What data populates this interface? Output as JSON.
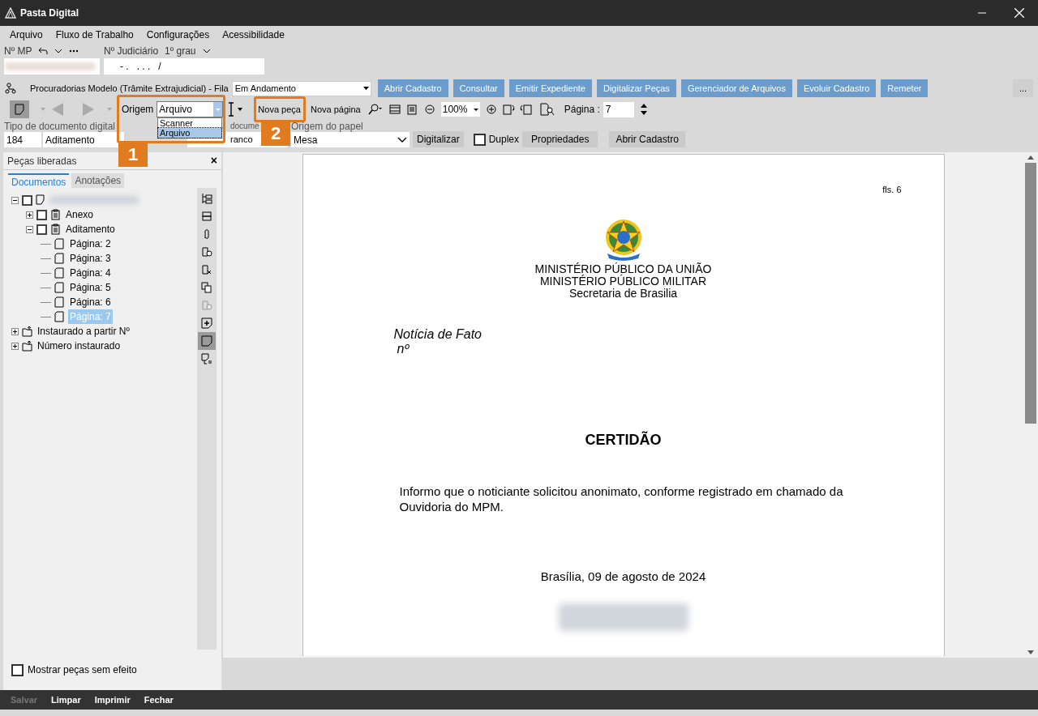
{
  "window": {
    "title": "Pasta Digital"
  },
  "menu": [
    "Arquivo",
    "Fluxo de Trabalho",
    "Configurações",
    "Acessibilidade"
  ],
  "header": {
    "mp_label": "Nº MP",
    "judiciario_label": "Nº Judiciário",
    "grau": "1º grau",
    "judiciario_value": "- .   . . .   /"
  },
  "fila": {
    "label": "Procuradorias Modelo (Trâmite Extrajudicial) - Fila",
    "value": "Em Andamento"
  },
  "actions": [
    "Abrir Cadastro",
    "Consultar",
    "Emitir Expediente",
    "Digitalizar Peças",
    "Gerenciador de Arquivos",
    "Evoluir Cadastro",
    "Remeter"
  ],
  "more_button": "...",
  "toolbar": {
    "origem_label": "Origem",
    "origem_value": "Arquivo",
    "origem_options": [
      {
        "label": "Scanner",
        "selected": false
      },
      {
        "label": "Arquivo",
        "selected": true
      }
    ],
    "nova_peca": "Nova peça",
    "nova_pagina": "Nova página",
    "zoom": "100%",
    "pagina_label": "Página :",
    "pagina_value": "7"
  },
  "form": {
    "tipo_label": "Tipo de documento digital",
    "tipo_code": "184",
    "tipo_value": "Aditamento",
    "doc_label": "docume",
    "doc_value": "ranco",
    "origem_papel_label": "Origem do papel",
    "origem_papel_value": "Mesa",
    "digitalizar": "Digitalizar",
    "duplex": {
      "label": "Duplex",
      "checked": false
    },
    "propriedades": "Propriedades",
    "abrir_cadastro": "Abrir Cadastro"
  },
  "panel": {
    "title": "Peças liberadas",
    "close": "×",
    "tabs": [
      {
        "label": "Documentos",
        "selected": true
      },
      {
        "label": "Anotações",
        "selected": false
      }
    ],
    "tree": [
      {
        "kind": "document",
        "checked": false,
        "expanded": true,
        "children": [
          {
            "kind": "folder",
            "label": "Anexo",
            "checked": false,
            "expanded": false
          },
          {
            "kind": "folder",
            "label": "Aditamento",
            "checked": false,
            "expanded": true,
            "children": [
              {
                "kind": "page",
                "label": "Página: 2",
                "selected": false
              },
              {
                "kind": "page",
                "label": "Página: 3",
                "selected": false
              },
              {
                "kind": "page",
                "label": "Página: 4",
                "selected": false
              },
              {
                "kind": "page",
                "label": "Página: 5",
                "selected": false
              },
              {
                "kind": "page",
                "label": "Página: 6",
                "selected": false
              },
              {
                "kind": "page",
                "label": "Página: 7",
                "selected": true
              }
            ]
          }
        ]
      },
      {
        "kind": "process",
        "label": "Instaurado a partir Nº",
        "expanded": false
      },
      {
        "kind": "process",
        "label": "Número instaurado",
        "expanded": false
      }
    ],
    "tools": [
      {
        "kind": "tree",
        "selected": false,
        "disabled": false
      },
      {
        "kind": "stack",
        "selected": false,
        "disabled": false
      },
      {
        "kind": "clip",
        "selected": false,
        "disabled": false
      },
      {
        "kind": "seal",
        "selected": false,
        "disabled": false
      },
      {
        "kind": "remove",
        "selected": false,
        "disabled": false
      },
      {
        "kind": "copy",
        "selected": false,
        "disabled": false
      },
      {
        "kind": "seal",
        "selected": false,
        "disabled": true
      },
      {
        "kind": "add",
        "selected": false,
        "disabled": false
      },
      {
        "kind": "note",
        "selected": true,
        "disabled": false
      },
      {
        "kind": "list",
        "selected": false,
        "disabled": false
      }
    ],
    "show_void": {
      "label": "Mostrar peças sem efeito",
      "checked": false
    }
  },
  "document": {
    "folio": "fls. 6",
    "heading": [
      "MINISTÉRIO PÚBLICO DA UNIÃO",
      "MINISTÉRIO PÚBLICO MILITAR",
      "Secretaria de Brasilia"
    ],
    "subject": [
      "Notícia de Fato",
      "nº"
    ],
    "title": "CERTIDÃO",
    "body": "Informo que o noticiante solicitou anonimato, conforme registrado em chamado da Ouvidoria do MPM.",
    "date": "Brasília, 09 de agosto de 2024"
  },
  "callouts": [
    "1",
    "2"
  ],
  "footer": [
    {
      "label": "Salvar",
      "disabled": true
    },
    {
      "label": "Limpar",
      "disabled": false
    },
    {
      "label": "Imprimir",
      "disabled": false
    },
    {
      "label": "Fechar",
      "disabled": false
    }
  ]
}
